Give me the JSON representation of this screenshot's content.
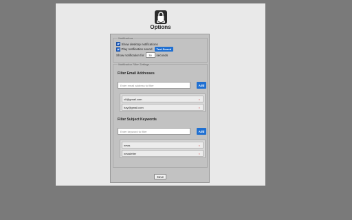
{
  "page": {
    "title": "Options"
  },
  "notifications": {
    "legend": "Notifications",
    "show_desktop_label": "Show desktop notifications",
    "show_desktop_checked": true,
    "play_sound_label": "Play notification sound",
    "play_sound_checked": true,
    "test_sound_label": "Test Sound",
    "show_for_label": "Show notification for",
    "show_for_value": "30",
    "seconds_label": "seconds"
  },
  "filter_settings": {
    "legend": "Notification Filter Settings",
    "emails": {
      "heading": "Filter Email Addresses",
      "placeholder": "Enter email address to filter",
      "add_label": "Add",
      "items": [
        {
          "label": "x0@gmail.com",
          "remove": "×"
        },
        {
          "label": "hay@gmail.com",
          "remove": "×"
        }
      ]
    },
    "keywords": {
      "heading": "Filter Subject Keywords",
      "placeholder": "Enter keyword to filter",
      "add_label": "Add",
      "items": [
        {
          "label": "news",
          "remove": "×"
        },
        {
          "label": "newsletter",
          "remove": "×"
        }
      ]
    }
  },
  "save_label": "Save",
  "icons": {
    "logo": "envelope-lock-icon",
    "remove": "close-icon",
    "check": "check-icon"
  },
  "colors": {
    "accent": "#1f6fd1",
    "background": "#7a7a7a",
    "sheet": "#e9e9e9",
    "panel": "#c2c2c2"
  }
}
